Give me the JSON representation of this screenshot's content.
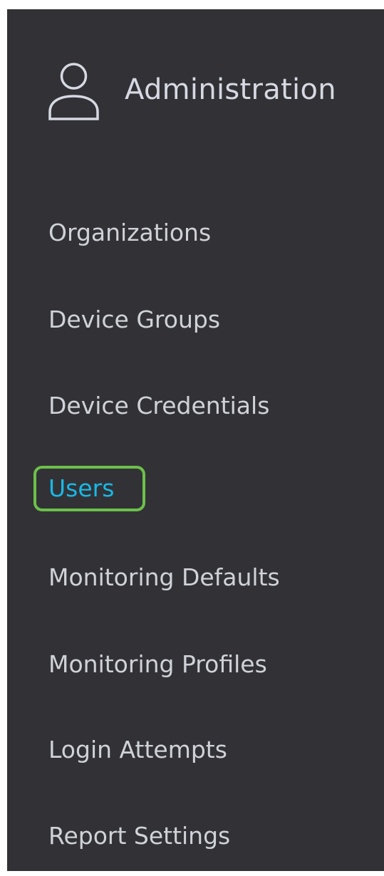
{
  "header": {
    "icon": "user-icon",
    "title": "Administration"
  },
  "nav": {
    "items": [
      {
        "label": "Organizations",
        "active": false
      },
      {
        "label": "Device Groups",
        "active": false
      },
      {
        "label": "Device Credentials",
        "active": false
      },
      {
        "label": "Users",
        "active": true
      },
      {
        "label": "Monitoring Defaults",
        "active": false
      },
      {
        "label": "Monitoring Profiles",
        "active": false
      },
      {
        "label": "Login Attempts",
        "active": false
      },
      {
        "label": "Report Settings",
        "active": false
      }
    ]
  },
  "colors": {
    "panel_background": "#323236",
    "text": "#cfd2d8",
    "active_text": "#19b8e6",
    "highlight_border": "#6cc04a"
  }
}
